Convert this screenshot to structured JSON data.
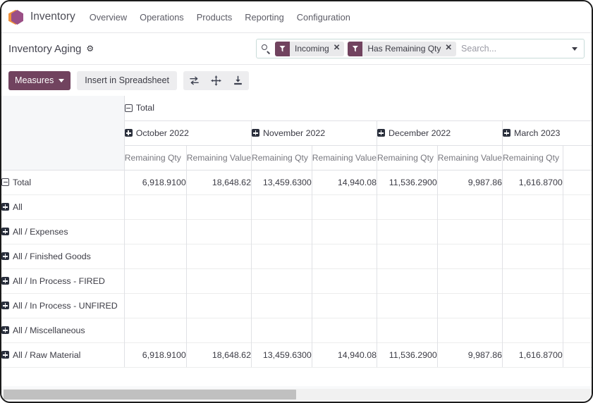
{
  "window": {
    "accent_purple": "#71435f",
    "logo_orange": "#f0913a",
    "logo_purple": "#9b4f86"
  },
  "navbar": {
    "app_name": "Inventory",
    "logo_icon": "odoo-inventory-hexagon-icon",
    "items": [
      {
        "label": "Overview"
      },
      {
        "label": "Operations"
      },
      {
        "label": "Products"
      },
      {
        "label": "Reporting"
      },
      {
        "label": "Configuration"
      }
    ]
  },
  "control_panel": {
    "breadcrumb": "Inventory Aging",
    "gear_icon": "gear-icon",
    "search": {
      "search_icon": "search-icon",
      "placeholder": "Search...",
      "value": "",
      "dropdown_icon": "chevron-down-icon",
      "facets": [
        {
          "icon": "filter-funnel-icon",
          "label": "Incoming",
          "remove_icon": "close-icon"
        },
        {
          "icon": "filter-funnel-icon",
          "label": "Has Remaining Qty",
          "remove_icon": "close-icon"
        }
      ]
    }
  },
  "toolbar": {
    "measures_label": "Measures",
    "measures_caret_icon": "chevron-down-icon",
    "insert_spreadsheet_label": "Insert in Spreadsheet",
    "icons": [
      {
        "name": "flip-axis-icon"
      },
      {
        "name": "expand-all-icon"
      },
      {
        "name": "download-xlsx-icon"
      }
    ]
  },
  "pivot": {
    "col_root": {
      "label": "Total",
      "toggle_icon": "collapse-minus-icon"
    },
    "col_groups": [
      {
        "label": "October 2022",
        "toggle_icon": "expand-plus-icon",
        "measures": [
          "Remaining Qty",
          "Remaining Value"
        ]
      },
      {
        "label": "November 2022",
        "toggle_icon": "expand-plus-icon",
        "measures": [
          "Remaining Qty",
          "Remaining Value"
        ]
      },
      {
        "label": "December 2022",
        "toggle_icon": "expand-plus-icon",
        "measures": [
          "Remaining Qty",
          "Remaining Value"
        ]
      },
      {
        "label": "March 2023",
        "toggle_icon": "expand-plus-icon",
        "measures": [
          "Remaining Qty"
        ]
      }
    ],
    "rows": [
      {
        "label": "Total",
        "toggle_icon": "collapse-minus-icon",
        "indent": 0,
        "is_total": true,
        "values": [
          "6,918.9100",
          "18,648.62",
          "13,459.6300",
          "14,940.08",
          "11,536.2900",
          "9,987.86",
          "1,616.8700"
        ]
      },
      {
        "label": "All",
        "toggle_icon": "expand-plus-icon",
        "indent": 1,
        "is_total": false,
        "values": [
          "",
          "",
          "",
          "",
          "",
          "",
          ""
        ]
      },
      {
        "label": "All / Expenses",
        "toggle_icon": "expand-plus-icon",
        "indent": 1,
        "is_total": false,
        "values": [
          "",
          "",
          "",
          "",
          "",
          "",
          ""
        ]
      },
      {
        "label": "All / Finished Goods",
        "toggle_icon": "expand-plus-icon",
        "indent": 1,
        "is_total": false,
        "values": [
          "",
          "",
          "",
          "",
          "",
          "",
          ""
        ]
      },
      {
        "label": "All / In Process - FIRED",
        "toggle_icon": "expand-plus-icon",
        "indent": 1,
        "is_total": false,
        "values": [
          "",
          "",
          "",
          "",
          "",
          "",
          ""
        ]
      },
      {
        "label": "All / In Process - UNFIRED",
        "toggle_icon": "expand-plus-icon",
        "indent": 1,
        "is_total": false,
        "values": [
          "",
          "",
          "",
          "",
          "",
          "",
          ""
        ]
      },
      {
        "label": "All / Miscellaneous",
        "toggle_icon": "expand-plus-icon",
        "indent": 1,
        "is_total": false,
        "values": [
          "",
          "",
          "",
          "",
          "",
          "",
          ""
        ]
      },
      {
        "label": "All / Raw Material",
        "toggle_icon": "expand-plus-icon",
        "indent": 1,
        "is_total": false,
        "values": [
          "6,918.9100",
          "18,648.62",
          "13,459.6300",
          "14,940.08",
          "11,536.2900",
          "9,987.86",
          "1,616.8700"
        ]
      }
    ]
  },
  "scrollbar": {
    "orientation": "horizontal",
    "thumb_fraction": "0.5"
  }
}
